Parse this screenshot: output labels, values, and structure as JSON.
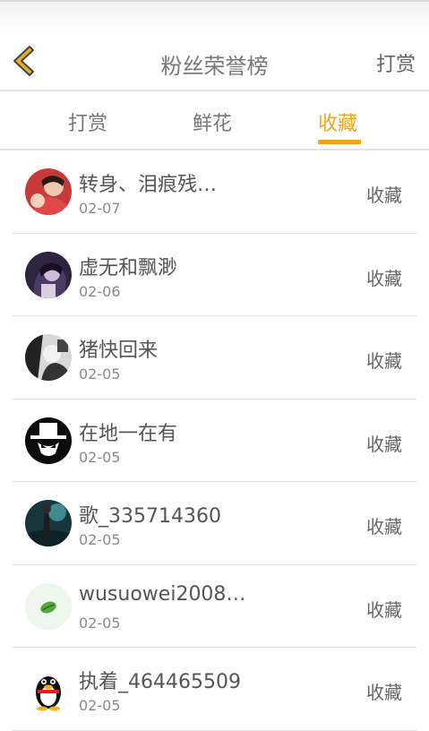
{
  "header": {
    "title": "粉丝荣誉榜",
    "reward_label": "打赏"
  },
  "tabs": [
    {
      "label": "打赏"
    },
    {
      "label": "鲜花"
    },
    {
      "label": "收藏"
    }
  ],
  "colors": {
    "accent": "#f0a516",
    "back_arrow_fill": "#e8b020"
  },
  "rows": [
    {
      "name": "转身、泪痕残…",
      "date": "02-07",
      "action": "收藏",
      "avatar_icon": "user-photo-icon"
    },
    {
      "name": "虚无和飘渺",
      "date": "02-06",
      "action": "收藏",
      "avatar_icon": "user-photo-icon"
    },
    {
      "name": "猪快回来",
      "date": "02-05",
      "action": "收藏",
      "avatar_icon": "user-photo-icon"
    },
    {
      "name": "在地一在有",
      "date": "02-05",
      "action": "收藏",
      "avatar_icon": "hat-mask-icon"
    },
    {
      "name": "歌_335714360",
      "date": "02-05",
      "action": "收藏",
      "avatar_icon": "user-photo-icon"
    },
    {
      "name": "wusuowei2008…",
      "date": "02-05",
      "action": "收藏",
      "avatar_icon": "leaf-icon"
    },
    {
      "name": "执着_464465509",
      "date": "02-05",
      "action": "收藏",
      "avatar_icon": "penguin-icon"
    }
  ]
}
